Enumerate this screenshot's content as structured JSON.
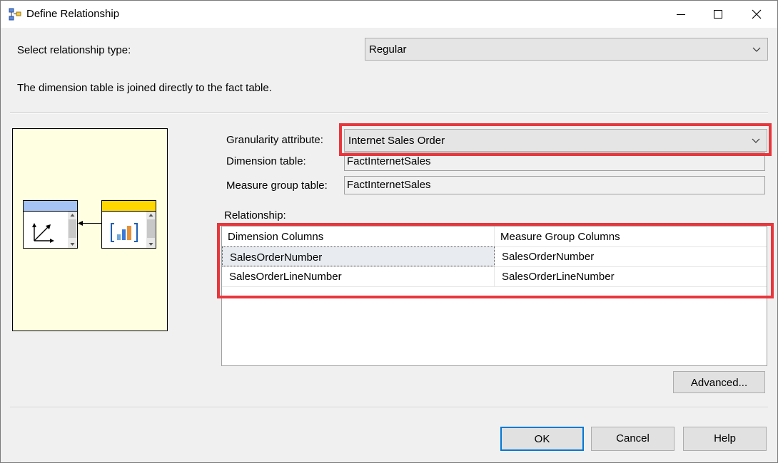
{
  "window": {
    "title": "Define Relationship",
    "icons": {
      "app": "relationship-app-icon",
      "minimize": "minimize-icon",
      "maximize": "maximize-icon",
      "close": "close-icon"
    }
  },
  "relationship_type": {
    "label": "Select relationship type:",
    "value": "Regular",
    "description": "The dimension table is joined directly to the fact table."
  },
  "details": {
    "granularity_label": "Granularity attribute:",
    "granularity_value": "Internet Sales Order",
    "dimension_table_label": "Dimension table:",
    "dimension_table_value": "FactInternetSales",
    "measure_group_label": "Measure group table:",
    "measure_group_value": "FactInternetSales"
  },
  "relationship": {
    "label": "Relationship:",
    "columns": [
      "Dimension Columns",
      "Measure Group Columns"
    ],
    "rows": [
      [
        "SalesOrderNumber",
        "SalesOrderNumber"
      ],
      [
        "SalesOrderLineNumber",
        "SalesOrderLineNumber"
      ]
    ]
  },
  "buttons": {
    "advanced": "Advanced...",
    "ok": "OK",
    "cancel": "Cancel",
    "help": "Help"
  },
  "colors": {
    "highlight": "#e8363c",
    "dimension_header": "#a5c4f5",
    "fact_header": "#ffd700",
    "diagram_bg": "#ffffe1"
  }
}
